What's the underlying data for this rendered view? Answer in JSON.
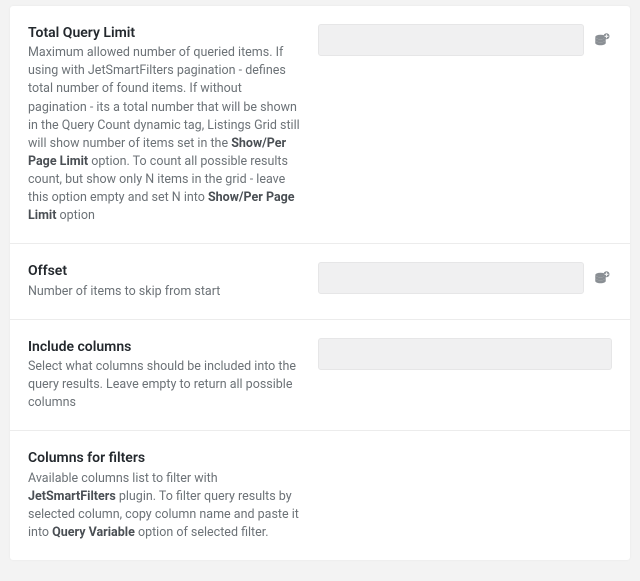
{
  "fields": {
    "total_query_limit": {
      "title": "Total Query Limit",
      "desc_pre": "Maximum allowed number of queried items. If using with JetSmartFilters pagination - defines total number of found items. If without pagination - its a total number that will be shown in the Query Count dynamic tag, Listings Grid still will show number of items set in the ",
      "desc_bold1": "Show/Per Page Limit",
      "desc_mid": " option. To count all possible results count, but show only N items in the grid - leave this option empty and set N into ",
      "desc_bold2": "Show/Per Page Limit",
      "desc_tail": " option",
      "value": ""
    },
    "offset": {
      "title": "Offset",
      "desc": "Number of items to skip from start",
      "value": ""
    },
    "include_columns": {
      "title": "Include columns",
      "desc": "Select what columns should be included into the query results. Leave empty to return all possible columns",
      "value": ""
    },
    "columns_filters": {
      "title": "Columns for filters",
      "desc_pre": "Available columns list to filter with ",
      "desc_bold1": "JetSmartFilters",
      "desc_mid": " plugin. To filter query results by selected column, copy column name and paste it into ",
      "desc_bold2": "Query Variable",
      "desc_tail": " option of selected filter."
    }
  }
}
